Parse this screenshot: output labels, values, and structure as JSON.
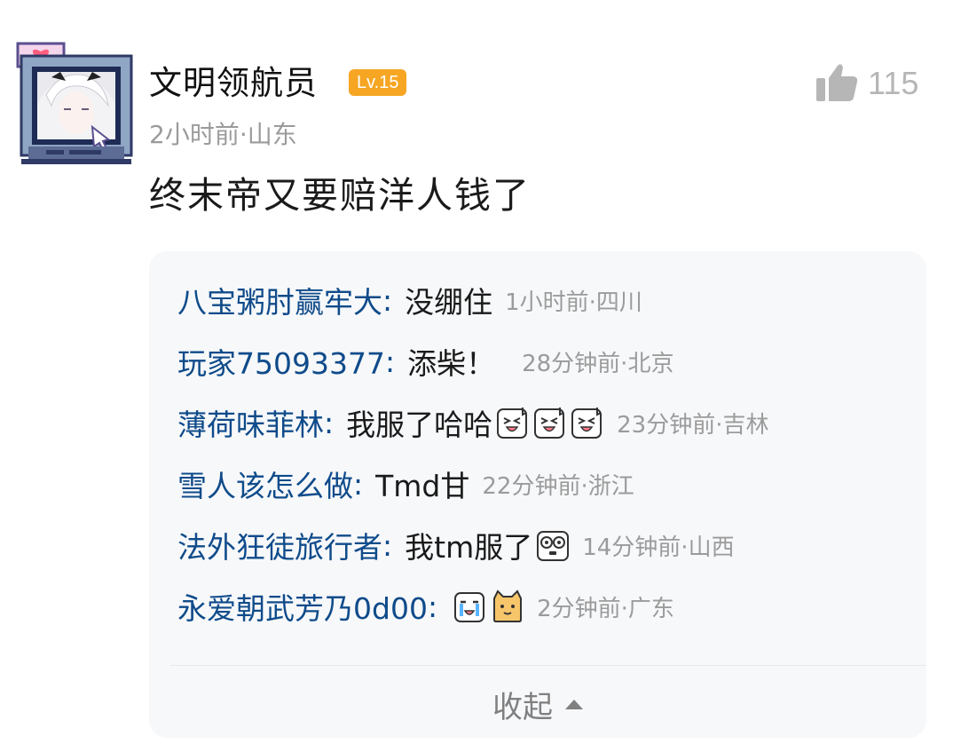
{
  "post": {
    "username": "文明领航员",
    "level": "Lv.15",
    "like_count": "115",
    "time_location": "2小时前·山东",
    "content": "终末帝又要赔洋人钱了"
  },
  "replies": [
    {
      "user": "八宝粥肘赢牢大",
      "separator": ":",
      "text": "没绷住",
      "emojis": [],
      "meta": "1小时前·四川"
    },
    {
      "user": "玩家75093377",
      "separator": ":",
      "text": "添柴！",
      "emojis": [],
      "meta": "28分钟前·北京"
    },
    {
      "user": "薄荷味菲林",
      "separator": ":",
      "text": "我服了哈哈",
      "emojis": [
        "laughing-singing-emoji",
        "laughing-singing-emoji",
        "laughing-singing-emoji"
      ],
      "meta": "23分钟前·吉林"
    },
    {
      "user": "雪人该怎么做",
      "separator": ":",
      "text": "Tmd甘",
      "emojis": [],
      "meta": "22分钟前·浙江"
    },
    {
      "user": "法外狂徒旅行者",
      "separator": ":",
      "text": "我tm服了",
      "emojis": [
        "stunned-emoji"
      ],
      "meta": "14分钟前·山西"
    },
    {
      "user": "永爱朝武芳乃0d00",
      "separator": ":",
      "text": "",
      "emojis": [
        "crying-emoji",
        "cat-emoji"
      ],
      "meta": "2分钟前·广东"
    }
  ],
  "collapse_label": "收起",
  "colors": {
    "username_link": "#0f4b8a",
    "badge": "#f6a623",
    "meta_gray": "#9b9b9b",
    "panel_bg": "#f7f8fa"
  },
  "icons": {
    "like": "thumbs-up-icon",
    "collapse": "caret-up-icon",
    "avatar_decoration": "heart-icon"
  }
}
